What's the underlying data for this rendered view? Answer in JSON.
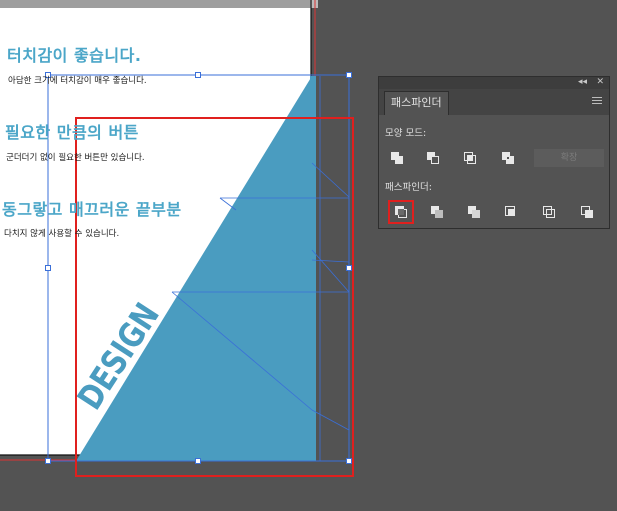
{
  "document": {
    "sections": [
      {
        "heading": "터치감이 좋습니다.",
        "body": "아담한 크기에 터치감이 매우 좋습니다."
      },
      {
        "heading": "필요한 만큼의 버튼",
        "body": "군더더기 없이 필요한 버튼만 있습니다."
      },
      {
        "heading": "동그랗고 매끄러운 끝부분",
        "body": "다치지 않게 사용할 수 있습니다."
      }
    ],
    "design_text": "DESIGN"
  },
  "colors": {
    "workspace": "#535353",
    "artboard": "#ffffff",
    "shape": "#4a9cc0",
    "heading": "#4ba6c8",
    "selection": "#3a6fd8",
    "highlight": "#e0201e"
  },
  "pathfinder_panel": {
    "collapse_label": "◂◂",
    "close_label": "✕",
    "tab_label": "패스파인더",
    "shape_modes_label": "모양 모드:",
    "expand_label": "확장",
    "pathfinders_label": "패스파인더:",
    "shape_modes": [
      {
        "name": "unite-icon"
      },
      {
        "name": "minus-front-icon"
      },
      {
        "name": "intersect-icon"
      },
      {
        "name": "exclude-icon"
      }
    ],
    "pathfinders": [
      {
        "name": "divide-icon",
        "selected": true
      },
      {
        "name": "trim-icon",
        "selected": false
      },
      {
        "name": "merge-icon",
        "selected": false
      },
      {
        "name": "crop-icon",
        "selected": false
      },
      {
        "name": "outline-icon",
        "selected": false
      },
      {
        "name": "minus-back-icon",
        "selected": false
      }
    ]
  }
}
